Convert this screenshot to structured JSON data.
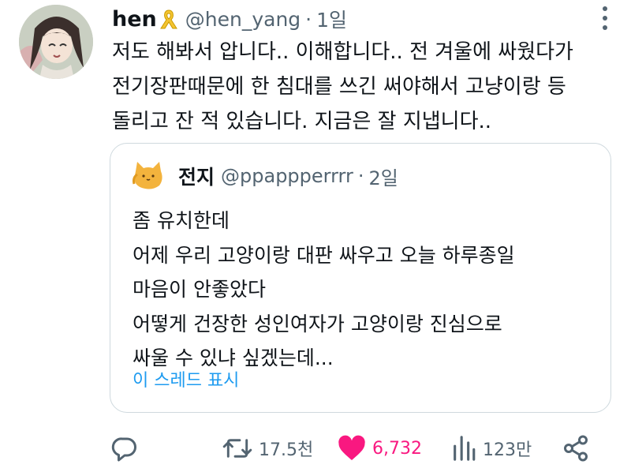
{
  "author": {
    "name": "hen",
    "handle": "@hen_yang",
    "separator": "·",
    "time": "1일",
    "ribbon_color": "#f4c430"
  },
  "tweet": {
    "lines": [
      "저도 해봐서 압니다.. 이해합니다.. 전 겨울에 싸웠다가",
      "전기장판때문에 한 침대를 쓰긴 써야해서 고냥이랑 등",
      "돌리고 잔 적 있습니다. 지금은 잘 지냅니다.."
    ]
  },
  "quoted": {
    "name": "전지",
    "handle": "@ppappperrrr",
    "separator": "·",
    "time": "2일",
    "lines": [
      "좀 유치한데",
      "어제 우리 고양이랑 대판 싸우고 오늘 하루종일",
      "마음이 안좋았다",
      "어떻게 건장한 성인여자가 고양이랑 진심으로",
      "싸울 수 있냐 싶겠는데..."
    ],
    "show_thread": "이 스레드 표시"
  },
  "actions": {
    "reply_icon": "reply-icon",
    "retweets": "17.5천",
    "likes": "6,732",
    "views": "123만",
    "like_color": "#f91880",
    "muted_color": "#536471",
    "link_color": "#1d9bf0"
  }
}
